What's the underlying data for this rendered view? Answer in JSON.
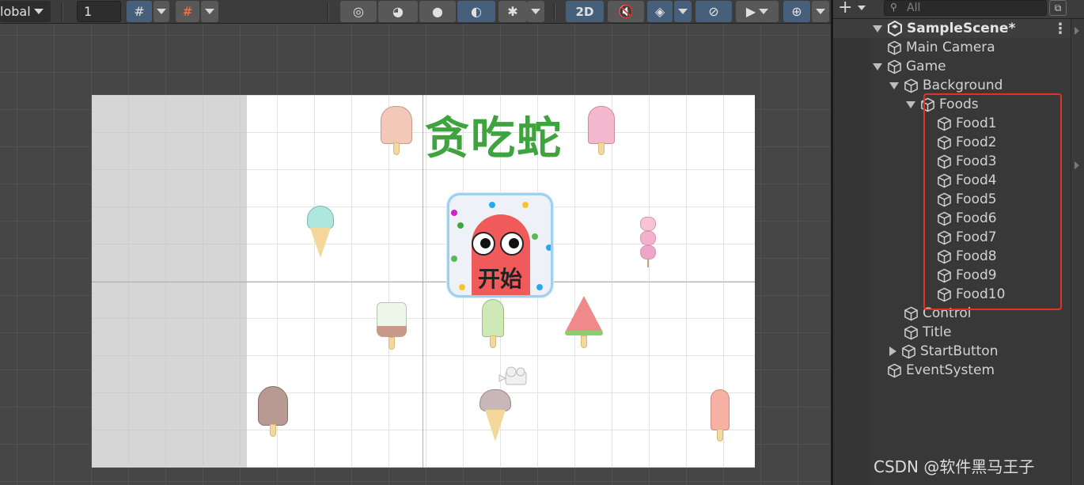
{
  "toolbar": {
    "pivot_label": "lobal",
    "grid_size_value": "1",
    "mode_2d": "2D"
  },
  "canvas": {
    "title": "贪吃蛇",
    "start_button_label": "开始"
  },
  "hierarchy": {
    "search_placeholder": "All",
    "scene_name": "SampleScene*",
    "items": [
      {
        "label": "Main Camera",
        "depth": 1,
        "arrow": "none"
      },
      {
        "label": "Game",
        "depth": 1,
        "arrow": "down"
      },
      {
        "label": "Background",
        "depth": 2,
        "arrow": "down"
      },
      {
        "label": "Foods",
        "depth": 3,
        "arrow": "down"
      },
      {
        "label": "Food1",
        "depth": 4,
        "arrow": "none"
      },
      {
        "label": "Food2",
        "depth": 4,
        "arrow": "none"
      },
      {
        "label": "Food3",
        "depth": 4,
        "arrow": "none"
      },
      {
        "label": "Food4",
        "depth": 4,
        "arrow": "none"
      },
      {
        "label": "Food5",
        "depth": 4,
        "arrow": "none"
      },
      {
        "label": "Food6",
        "depth": 4,
        "arrow": "none"
      },
      {
        "label": "Food7",
        "depth": 4,
        "arrow": "none"
      },
      {
        "label": "Food8",
        "depth": 4,
        "arrow": "none"
      },
      {
        "label": "Food9",
        "depth": 4,
        "arrow": "none"
      },
      {
        "label": "Food10",
        "depth": 4,
        "arrow": "none"
      },
      {
        "label": "Control",
        "depth": 2,
        "arrow": "none"
      },
      {
        "label": "Title",
        "depth": 2,
        "arrow": "none"
      },
      {
        "label": "StartButton",
        "depth": 2,
        "arrow": "right"
      },
      {
        "label": "EventSystem",
        "depth": 1,
        "arrow": "none"
      }
    ]
  },
  "watermark": "CSDN @软件黑马王子",
  "colors": {
    "title_green": "#3fa33f",
    "snake_red": "#f05a5a",
    "highlight_red": "#e0312b",
    "active_blue": "#46607c"
  }
}
